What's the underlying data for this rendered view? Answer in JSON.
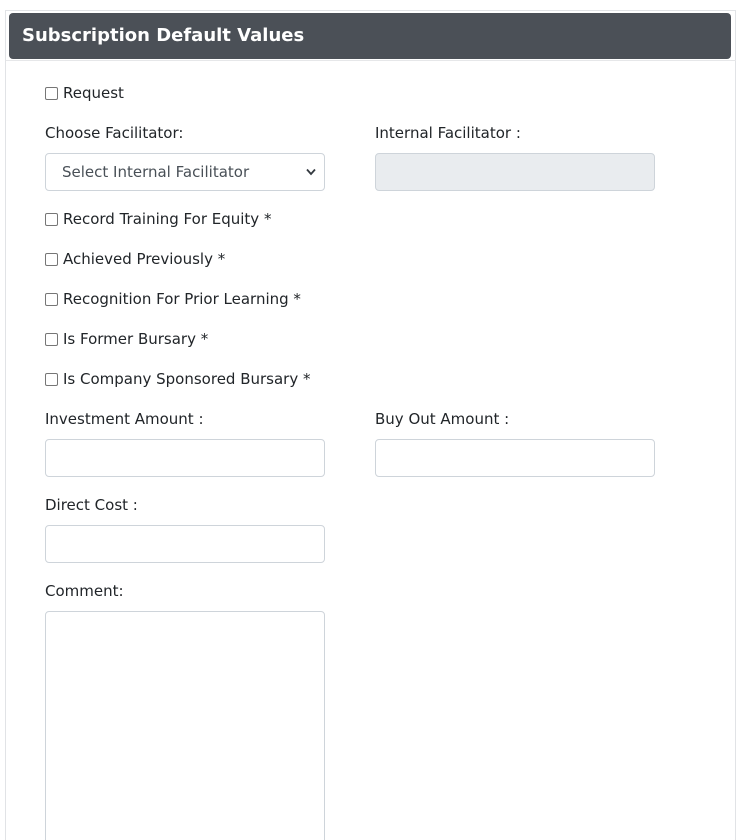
{
  "card": {
    "title": "Subscription Default Values"
  },
  "request": {
    "label": "Request",
    "checked": false
  },
  "facilitator": {
    "choose_label": "Choose Facilitator:",
    "select_value": "Select Internal Facilitator",
    "internal_label": "Internal Facilitator :",
    "internal_value": ""
  },
  "checkboxes": [
    {
      "label": "Record Training For Equity *",
      "checked": false
    },
    {
      "label": "Achieved Previously *",
      "checked": false
    },
    {
      "label": "Recognition For Prior Learning *",
      "checked": false
    },
    {
      "label": "Is Former Bursary *",
      "checked": false
    },
    {
      "label": "Is Company Sponsored Bursary *",
      "checked": false
    }
  ],
  "amounts": {
    "investment_label": "Investment Amount :",
    "investment_value": "",
    "buyout_label": "Buy Out Amount :",
    "buyout_value": "",
    "direct_cost_label": "Direct Cost :",
    "direct_cost_value": ""
  },
  "comment": {
    "label": "Comment:",
    "value": ""
  },
  "icons": {
    "select_arrow": "chevron-down-icon"
  }
}
